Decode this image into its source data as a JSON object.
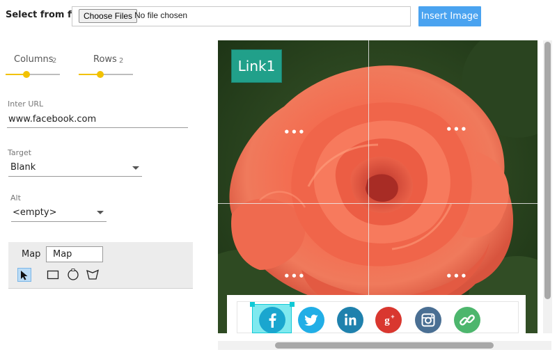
{
  "file_bar": {
    "label": "Select from files",
    "choose_button": "Choose Files",
    "status": "No file chosen",
    "insert_button": "Insert Image"
  },
  "grid_controls": {
    "columns": {
      "label": "Columns",
      "value": "2"
    },
    "rows": {
      "label": "Rows",
      "value": "2"
    }
  },
  "fields": {
    "url": {
      "label": "Inter URL",
      "value": "www.facebook.com"
    },
    "target": {
      "label": "Target",
      "value": "Blank"
    },
    "alt": {
      "label": "Alt",
      "value": "<empty>"
    }
  },
  "map_panel": {
    "label": "Map",
    "input_value": "Map",
    "tools": [
      "pointer-icon",
      "rectangle-icon",
      "circle-icon",
      "polygon-icon"
    ]
  },
  "canvas": {
    "badge": "Link1",
    "cell_menu": "•••"
  },
  "social_icons": [
    {
      "name": "facebook-icon",
      "glyph": "f",
      "color": "#1aa6cf"
    },
    {
      "name": "twitter-icon",
      "glyph": "🐦",
      "color": "#21aee6"
    },
    {
      "name": "linkedin-icon",
      "glyph": "in",
      "color": "#1f81ad"
    },
    {
      "name": "google-plus-icon",
      "glyph": "g+",
      "color": "#d9372f"
    },
    {
      "name": "instagram-icon",
      "glyph": "▣",
      "color": "#4a6f93"
    },
    {
      "name": "link-icon",
      "glyph": "🔗",
      "color": "#4db66d"
    }
  ],
  "colors": {
    "accent": "#4aa3f0",
    "slider": "#f2c200",
    "badge": "#21a08a",
    "selection": "#10c9d6"
  }
}
